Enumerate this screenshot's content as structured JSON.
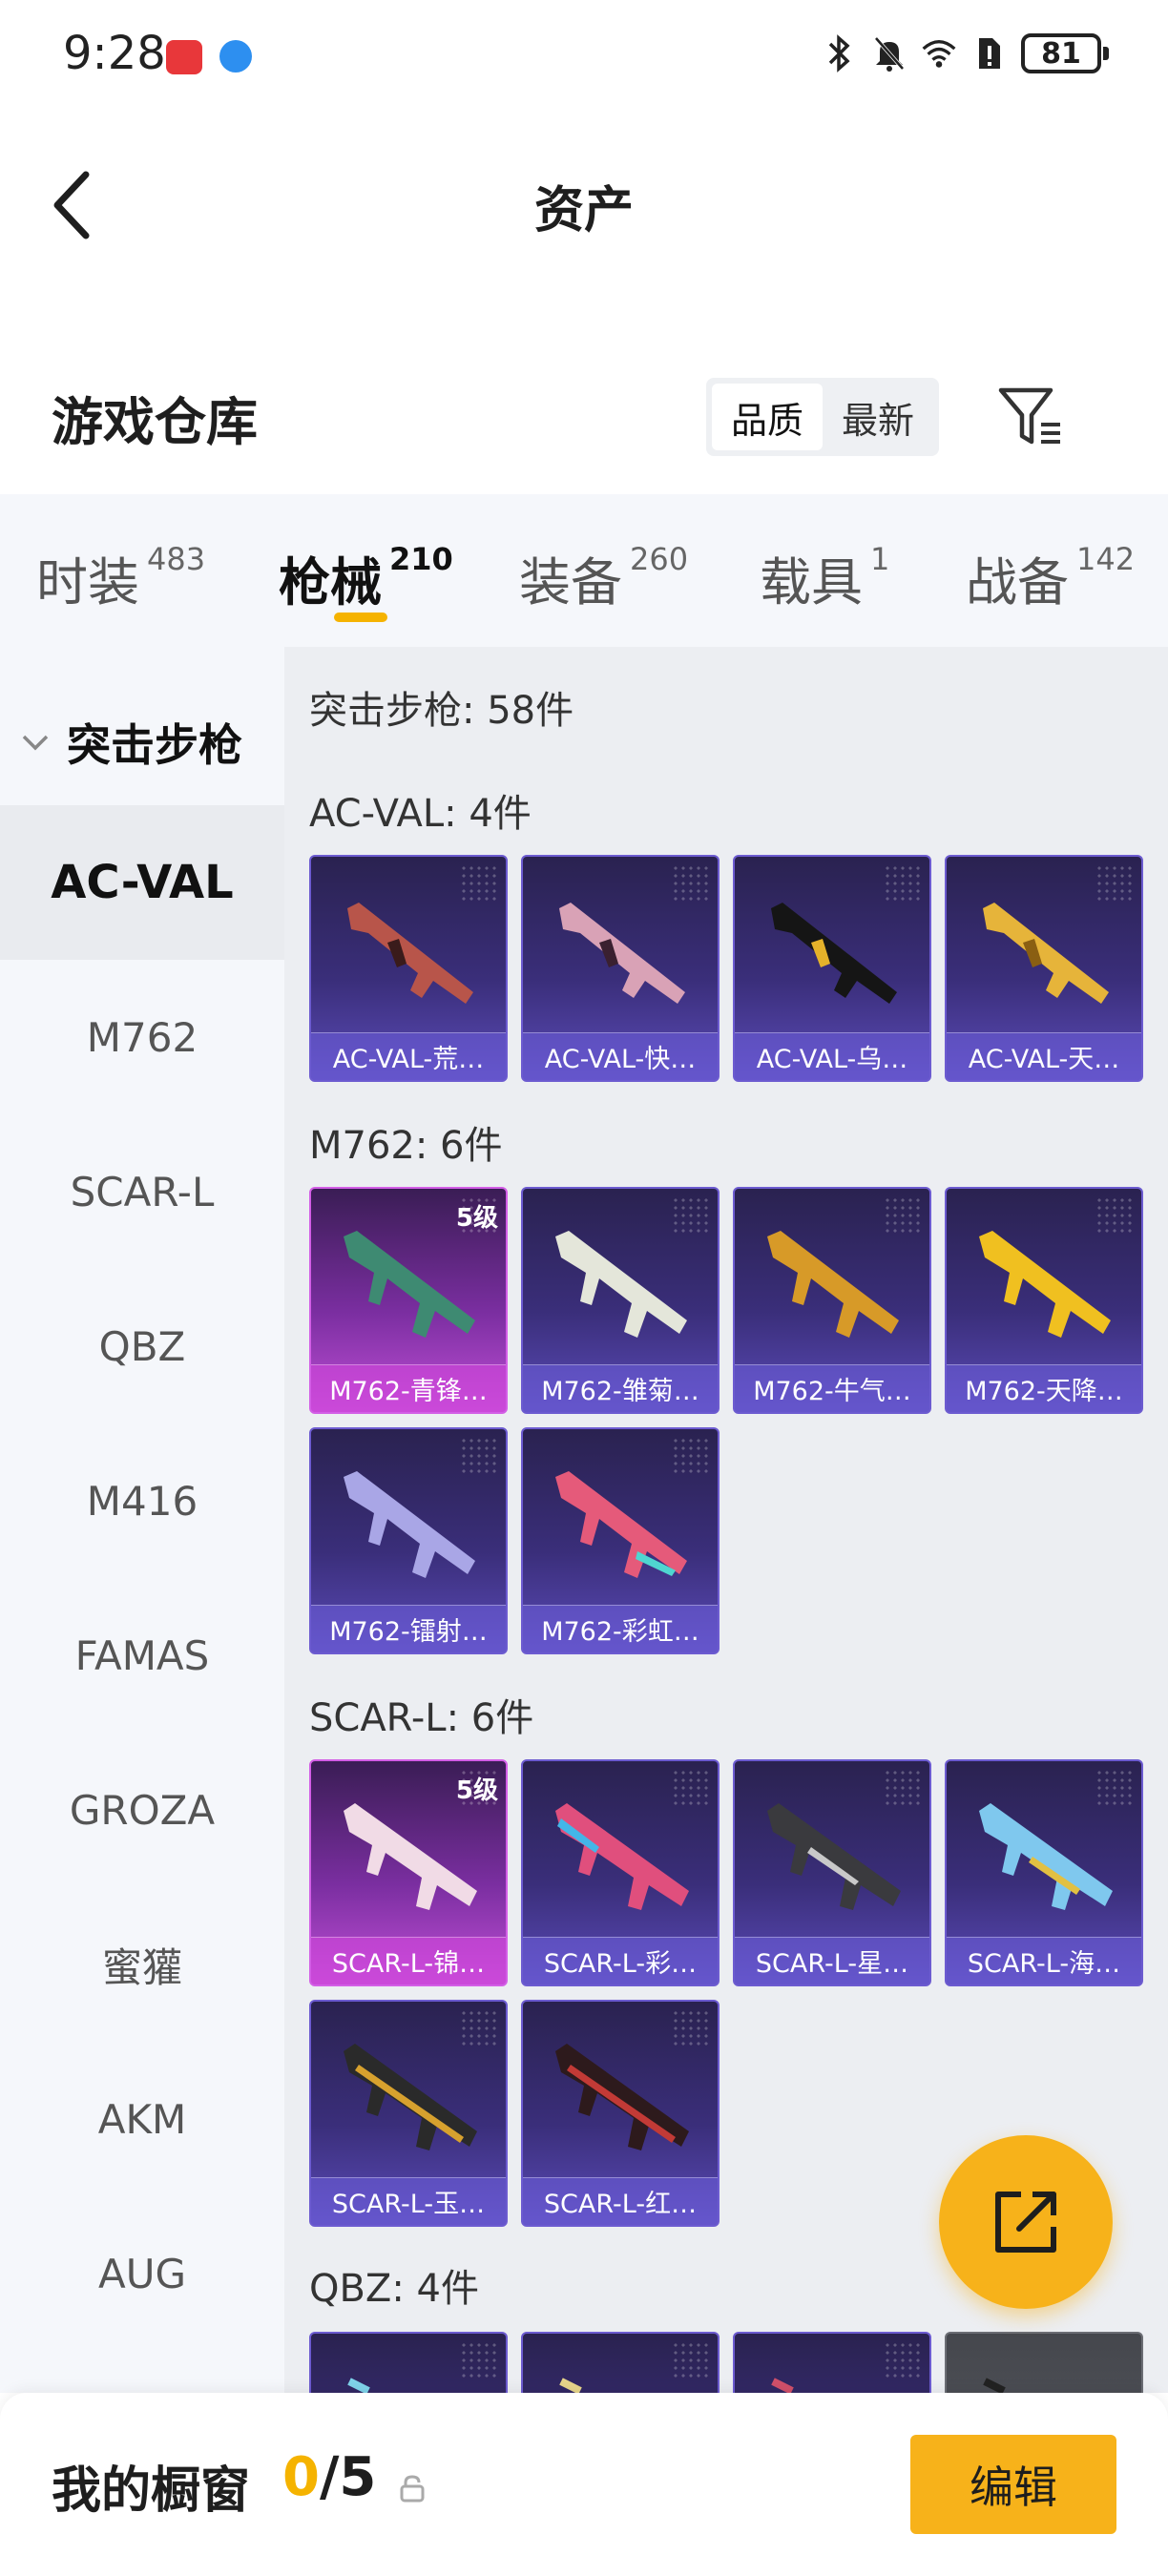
{
  "status_bar": {
    "time": "9:28",
    "battery": "81"
  },
  "header": {
    "title": "资产"
  },
  "warehouse": {
    "title": "游戏仓库",
    "sort_options": [
      "品质",
      "最新"
    ],
    "active_sort": "品质"
  },
  "tabs": [
    {
      "label": "时装",
      "count": "483"
    },
    {
      "label": "枪械",
      "count": "210"
    },
    {
      "label": "装备",
      "count": "260"
    },
    {
      "label": "载具",
      "count": "1"
    },
    {
      "label": "战备",
      "count": "142"
    }
  ],
  "active_tab": "枪械",
  "sidebar": {
    "category": "突击步枪",
    "items": [
      "AC-VAL",
      "M762",
      "SCAR-L",
      "QBZ",
      "M416",
      "FAMAS",
      "GROZA",
      "蜜獾",
      "AKM",
      "AUG"
    ],
    "active_item": "AC-VAL"
  },
  "content": {
    "category_title": "突击步枪: 58件",
    "groups": [
      {
        "label": "AC-VAL: 4件",
        "cards": [
          {
            "name": "AC-VAL-荒…",
            "level": ""
          },
          {
            "name": "AC-VAL-快…",
            "level": ""
          },
          {
            "name": "AC-VAL-乌…",
            "level": ""
          },
          {
            "name": "AC-VAL-天…",
            "level": ""
          }
        ]
      },
      {
        "label": "M762: 6件",
        "cards": [
          {
            "name": "M762-青锋…",
            "level": "5级"
          },
          {
            "name": "M762-雏菊…",
            "level": ""
          },
          {
            "name": "M762-牛气…",
            "level": ""
          },
          {
            "name": "M762-天降…",
            "level": ""
          },
          {
            "name": "M762-镭射…",
            "level": ""
          },
          {
            "name": "M762-彩虹…",
            "level": ""
          }
        ]
      },
      {
        "label": "SCAR-L: 6件",
        "cards": [
          {
            "name": "SCAR-L-锦…",
            "level": "5级"
          },
          {
            "name": "SCAR-L-彩…",
            "level": ""
          },
          {
            "name": "SCAR-L-星…",
            "level": ""
          },
          {
            "name": "SCAR-L-海…",
            "level": ""
          },
          {
            "name": "SCAR-L-玉…",
            "level": ""
          },
          {
            "name": "SCAR-L-红…",
            "level": ""
          }
        ]
      },
      {
        "label": "QBZ: 4件",
        "cards": []
      }
    ]
  },
  "showcase": {
    "label": "我的橱窗",
    "current": "0",
    "total": "/5",
    "edit_label": "编辑"
  }
}
